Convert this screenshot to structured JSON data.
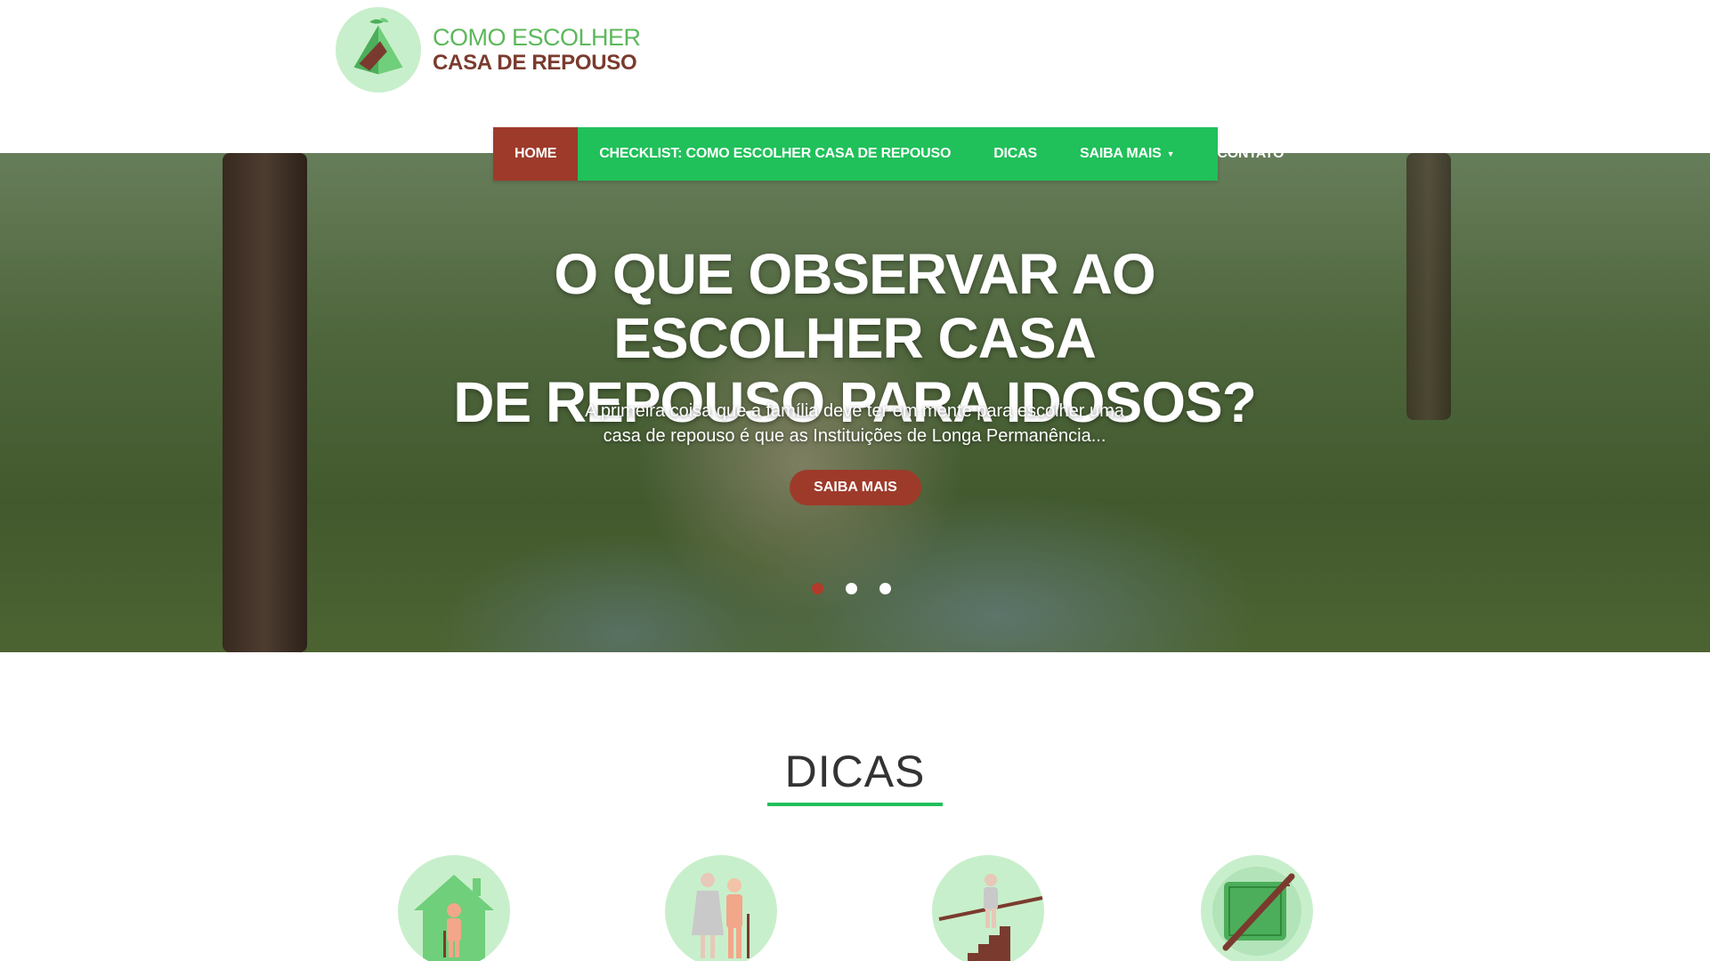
{
  "logo": {
    "line1": "COMO ESCOLHER",
    "line2": "CASA DE REPOUSO"
  },
  "nav": {
    "items": [
      {
        "label": "HOME",
        "active": true
      },
      {
        "label": "CHECKLIST: COMO ESCOLHER CASA DE REPOUSO",
        "active": false
      },
      {
        "label": "DICAS",
        "active": false
      },
      {
        "label": "SAIBA MAIS",
        "active": false,
        "has_dropdown": true
      },
      {
        "label": "CONTATO",
        "active": false
      }
    ]
  },
  "hero": {
    "title_line1": "O QUE OBSERVAR AO ESCOLHER CASA",
    "title_line2": "DE REPOUSO PARA IDOSOS?",
    "text_line1": "A primeira coisa que a família deve ter em mente para escolher uma",
    "text_line2": "casa de repouso é que as Instituições de Longa Permanência...",
    "button_label": "SAIBA MAIS",
    "slide_count": 3,
    "active_slide": 1
  },
  "dicas": {
    "title": "DICAS",
    "icons": [
      "house-elderly-icon",
      "elderly-couple-icon",
      "stairs-handrail-icon",
      "no-carpet-icon"
    ]
  },
  "colors": {
    "green": "#20c05a",
    "brown": "#9e3a2a",
    "light_green": "#c8efcb",
    "logo_green": "#5cb85c",
    "logo_brown": "#7a3b2e"
  }
}
